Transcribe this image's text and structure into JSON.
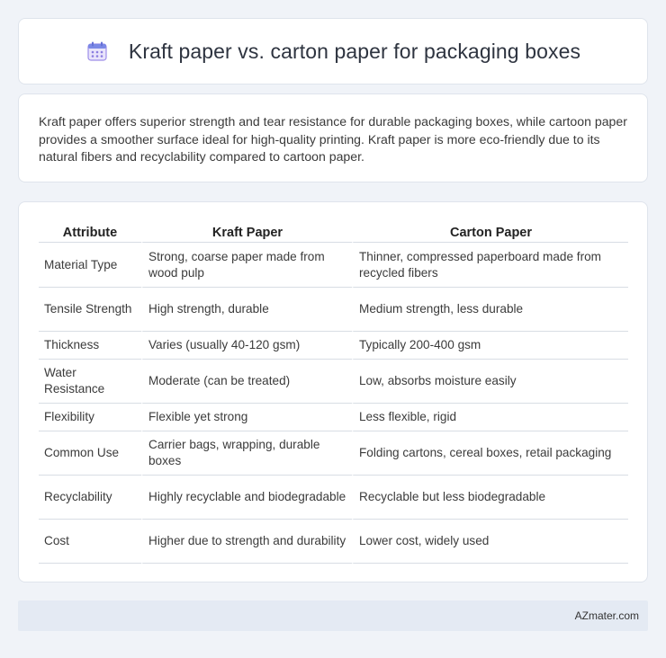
{
  "header": {
    "icon": "calendar-icon",
    "title": "Kraft paper vs. carton paper for packaging boxes"
  },
  "summary": {
    "text": "Kraft paper offers superior strength and tear resistance for durable packaging boxes, while cartoon paper provides a smoother surface ideal for high-quality printing. Kraft paper is more eco-friendly due to its natural fibers and recyclability compared to cartoon paper."
  },
  "table": {
    "headers": [
      "Attribute",
      "Kraft Paper",
      "Carton Paper"
    ],
    "rows": [
      [
        "Material Type",
        "Strong, coarse paper made from wood pulp",
        "Thinner, compressed paperboard made from recycled fibers"
      ],
      [
        "Tensile Strength",
        "High strength, durable",
        "Medium strength, less durable"
      ],
      [
        "Thickness",
        "Varies (usually 40-120 gsm)",
        "Typically 200-400 gsm"
      ],
      [
        "Water Resistance",
        "Moderate (can be treated)",
        "Low, absorbs moisture easily"
      ],
      [
        "Flexibility",
        "Flexible yet strong",
        "Less flexible, rigid"
      ],
      [
        "Common Use",
        "Carrier bags, wrapping, durable boxes",
        "Folding cartons, cereal boxes, retail packaging"
      ],
      [
        "Recyclability",
        "Highly recyclable and biodegradable",
        "Recyclable but less biodegradable"
      ],
      [
        "Cost",
        "Higher due to strength and durability",
        "Lower cost, widely used"
      ]
    ]
  },
  "footer": {
    "brand": "AZmater.com"
  }
}
